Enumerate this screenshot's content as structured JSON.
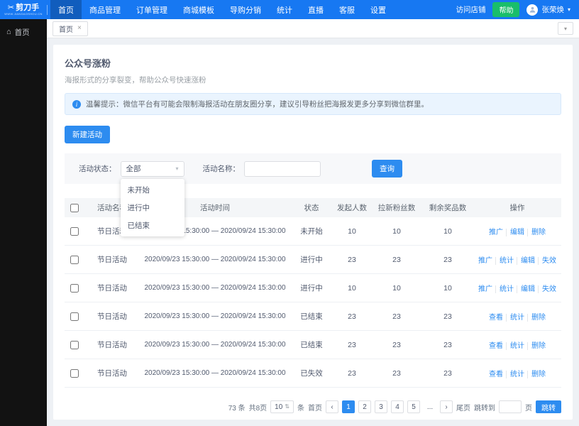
{
  "icons": {
    "scissors": "✂",
    "home": "⌂",
    "caret_down": "▾",
    "close": "×",
    "info": "i",
    "prev": "‹",
    "next": "›",
    "sizer_arrows": "⇅"
  },
  "navbar": {
    "logo_title": "剪刀手",
    "logo_subtitle": "WWW.JIANDAOSHOU.CN",
    "items": [
      {
        "label": "首页"
      },
      {
        "label": "商品管理"
      },
      {
        "label": "订单管理"
      },
      {
        "label": "商城模板"
      },
      {
        "label": "导购分销"
      },
      {
        "label": "统计"
      },
      {
        "label": "直播"
      },
      {
        "label": "客服"
      },
      {
        "label": "设置"
      }
    ],
    "visit_shop": "访问店铺",
    "help_label": "帮助",
    "user_name": "张荣焕"
  },
  "sidebar": {
    "home_label": "首页"
  },
  "tabbar": {
    "tab_label": "首页"
  },
  "page": {
    "title": "公众号涨粉",
    "subtitle": "海报形式的分享裂变，帮助公众号快速涨粉",
    "alert_text": "温馨提示：微信平台有可能会限制海报活动在朋友圈分享，建议引导粉丝把海报发更多分享到微信群里。",
    "new_activity_button": "新建活动"
  },
  "filters": {
    "status_label": "活动状态：",
    "status_value": "全部",
    "status_options": [
      "未开始",
      "进行中",
      "已结束"
    ],
    "name_label": "活动名称：",
    "name_value": "",
    "search_button": "查询"
  },
  "table": {
    "columns": [
      "活动名称",
      "活动时间",
      "状态",
      "发起人数",
      "拉新粉丝数",
      "剩余奖品数",
      "操作"
    ],
    "rows": [
      {
        "name": "节日活动",
        "time": "2020/09/23 15:30:00 — 2020/09/24 15:30:00",
        "status": "未开始",
        "initiators": "10",
        "new_fans": "10",
        "prizes": "10",
        "actions": [
          "推广",
          "编辑",
          "删除"
        ]
      },
      {
        "name": "节日活动",
        "time": "2020/09/23 15:30:00 — 2020/09/24 15:30:00",
        "status": "进行中",
        "initiators": "23",
        "new_fans": "23",
        "prizes": "23",
        "actions": [
          "推广",
          "统计",
          "编辑",
          "失效"
        ]
      },
      {
        "name": "节日活动",
        "time": "2020/09/23 15:30:00 — 2020/09/24 15:30:00",
        "status": "进行中",
        "initiators": "10",
        "new_fans": "10",
        "prizes": "10",
        "actions": [
          "推广",
          "统计",
          "编辑",
          "失效"
        ]
      },
      {
        "name": "节日活动",
        "time": "2020/09/23 15:30:00 — 2020/09/24 15:30:00",
        "status": "已结束",
        "initiators": "23",
        "new_fans": "23",
        "prizes": "23",
        "actions": [
          "查看",
          "统计",
          "删除"
        ]
      },
      {
        "name": "节日活动",
        "time": "2020/09/23 15:30:00 — 2020/09/24 15:30:00",
        "status": "已结束",
        "initiators": "23",
        "new_fans": "23",
        "prizes": "23",
        "actions": [
          "查看",
          "统计",
          "删除"
        ]
      },
      {
        "name": "节日活动",
        "time": "2020/09/23 15:30:00 — 2020/09/24 15:30:00",
        "status": "已失效",
        "initiators": "23",
        "new_fans": "23",
        "prizes": "23",
        "actions": [
          "查看",
          "统计",
          "删除"
        ]
      }
    ]
  },
  "pagination": {
    "total": "73 条",
    "pages_total": "共8页",
    "page_size": "10",
    "unit": "条",
    "first": "首页",
    "last": "尾页",
    "page_numbers": [
      "1",
      "2",
      "3",
      "4",
      "5",
      "..."
    ],
    "jump_label": "跳转到",
    "jump_unit": "页",
    "jump_button": "跳转"
  }
}
